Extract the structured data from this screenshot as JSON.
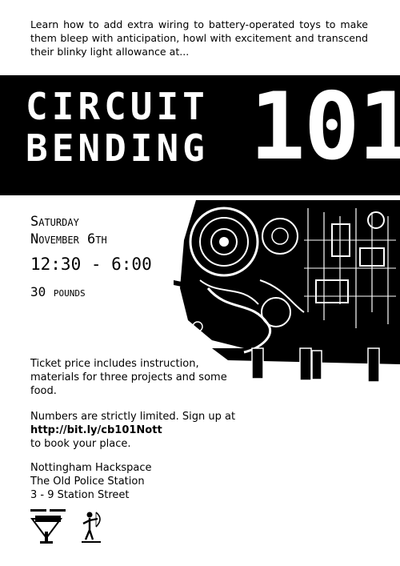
{
  "intro": "Learn how to add extra wiring to battery-operated toys to make them bleep with anticipation, howl with excitement and transcend their blinky light allowance at...",
  "title": {
    "line1": "CIRCUIT",
    "line2": "BENDING",
    "number": "101"
  },
  "event": {
    "day": "Saturday",
    "date": "November 6th",
    "time": "12:30 - 6:00",
    "price": "30 pounds"
  },
  "details": {
    "ticket_info": "Ticket price includes instruction, materials for three projects and some food.",
    "limited_text": "Numbers are strictly limited. Sign up at",
    "url": "http://bit.ly/cb101Nott",
    "booking_text": "to book your place."
  },
  "venue": {
    "name": "Nottingham Hackspace",
    "building": "The Old Police Station",
    "street": "3 - 9 Station Street"
  },
  "logos": {
    "logo1_icon": "hackspace-logo-icon",
    "logo2_icon": "archer-logo-icon"
  },
  "colors": {
    "banner": "#000000",
    "title_text": "#ffffff",
    "body_text": "#000000"
  }
}
